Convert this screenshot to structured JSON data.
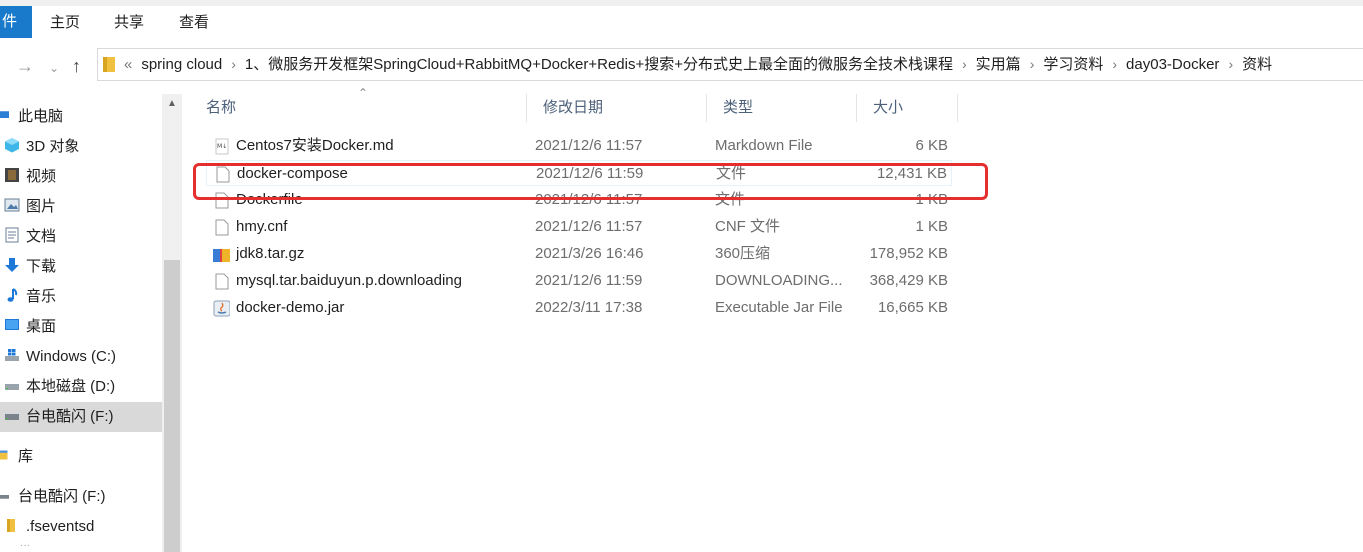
{
  "ribbon": {
    "tabs": [
      {
        "label": "件"
      },
      {
        "label": "主页"
      },
      {
        "label": "共享"
      },
      {
        "label": "查看"
      }
    ]
  },
  "address": {
    "lead": "«",
    "crumbs": [
      "spring cloud",
      "1、微服务开发框架SpringCloud+RabbitMQ+Docker+Redis+搜索+分布式史上最全面的微服务全技术栈课程",
      "实用篇",
      "学习资料",
      "day03-Docker",
      "资料"
    ]
  },
  "sidebar": {
    "items": [
      {
        "label": "此电脑",
        "icon": "pc-icon"
      },
      {
        "label": "3D 对象",
        "icon": "3d-objects-icon"
      },
      {
        "label": "视频",
        "icon": "video-icon"
      },
      {
        "label": "图片",
        "icon": "pictures-icon"
      },
      {
        "label": "文档",
        "icon": "documents-icon"
      },
      {
        "label": "下载",
        "icon": "downloads-icon"
      },
      {
        "label": "音乐",
        "icon": "music-icon"
      },
      {
        "label": "桌面",
        "icon": "desktop-icon"
      },
      {
        "label": "Windows (C:)",
        "icon": "windows-drive-icon"
      },
      {
        "label": "本地磁盘 (D:)",
        "icon": "drive-icon"
      },
      {
        "label": "台电酷闪 (F:)",
        "icon": "usb-drive-icon"
      },
      {
        "label": "库",
        "icon": "library-icon"
      },
      {
        "label": "台电酷闪 (F:)",
        "icon": "usb-drive-icon"
      },
      {
        "label": ".fseventsd",
        "icon": "folder-icon"
      }
    ]
  },
  "columns": {
    "name": "名称",
    "date": "修改日期",
    "type": "类型",
    "size": "大小"
  },
  "files": [
    {
      "name": "Centos7安装Docker.md",
      "date": "2021/12/6 11:57",
      "type": "Markdown File",
      "size": "6 KB",
      "icon": "markdown-file-icon"
    },
    {
      "name": "docker-compose",
      "date": "2021/12/6 11:59",
      "type": "文件",
      "size": "12,431 KB",
      "icon": "file-icon"
    },
    {
      "name": "Dockerfile",
      "date": "2021/12/6 11:57",
      "type": "文件",
      "size": "1 KB",
      "icon": "file-icon"
    },
    {
      "name": "hmy.cnf",
      "date": "2021/12/6 11:57",
      "type": "CNF 文件",
      "size": "1 KB",
      "icon": "file-icon"
    },
    {
      "name": "jdk8.tar.gz",
      "date": "2021/3/26 16:46",
      "type": "360压缩",
      "size": "178,952 KB",
      "icon": "archive-icon"
    },
    {
      "name": "mysql.tar.baiduyun.p.downloading",
      "date": "2021/12/6 11:59",
      "type": "DOWNLOADING...",
      "size": "368,429 KB",
      "icon": "file-icon"
    },
    {
      "name": "docker-demo.jar",
      "date": "2022/3/11 17:38",
      "type": "Executable Jar File",
      "size": "16,665 KB",
      "icon": "jar-file-icon"
    }
  ],
  "colors": {
    "annotation": "#e52f2f",
    "ribbon_file_tab": "#1979ca",
    "selection": "#d9d9d9"
  }
}
